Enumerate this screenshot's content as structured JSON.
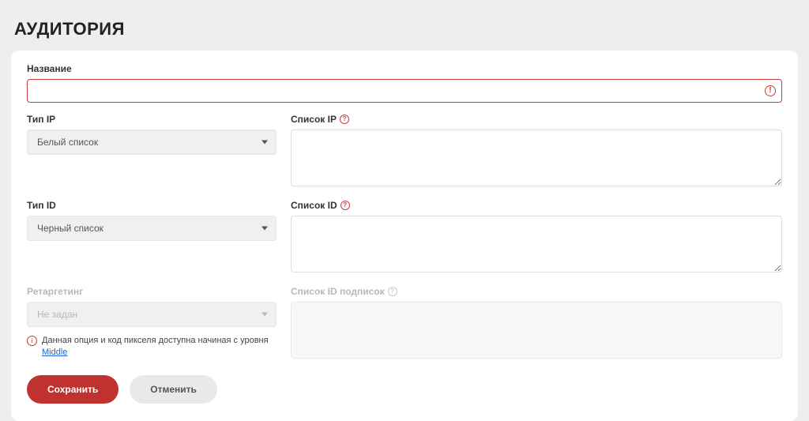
{
  "page": {
    "title": "АУДИТОРИЯ"
  },
  "form": {
    "name": {
      "label": "Название",
      "value": ""
    },
    "ip_type": {
      "label": "Тип IP",
      "selected": "Белый список"
    },
    "ip_list": {
      "label": "Список IP",
      "value": ""
    },
    "id_type": {
      "label": "Тип ID",
      "selected": "Черный список"
    },
    "id_list": {
      "label": "Список ID",
      "value": ""
    },
    "retargeting": {
      "label": "Ретаргетинг",
      "selected": "Не задан"
    },
    "subscription_list": {
      "label": "Список ID подписок",
      "value": ""
    },
    "info_note": {
      "text": "Данная опция и код пикселя доступна начиная с уровня ",
      "link": "Middle"
    }
  },
  "actions": {
    "save": "Сохранить",
    "cancel": "Отменить"
  }
}
